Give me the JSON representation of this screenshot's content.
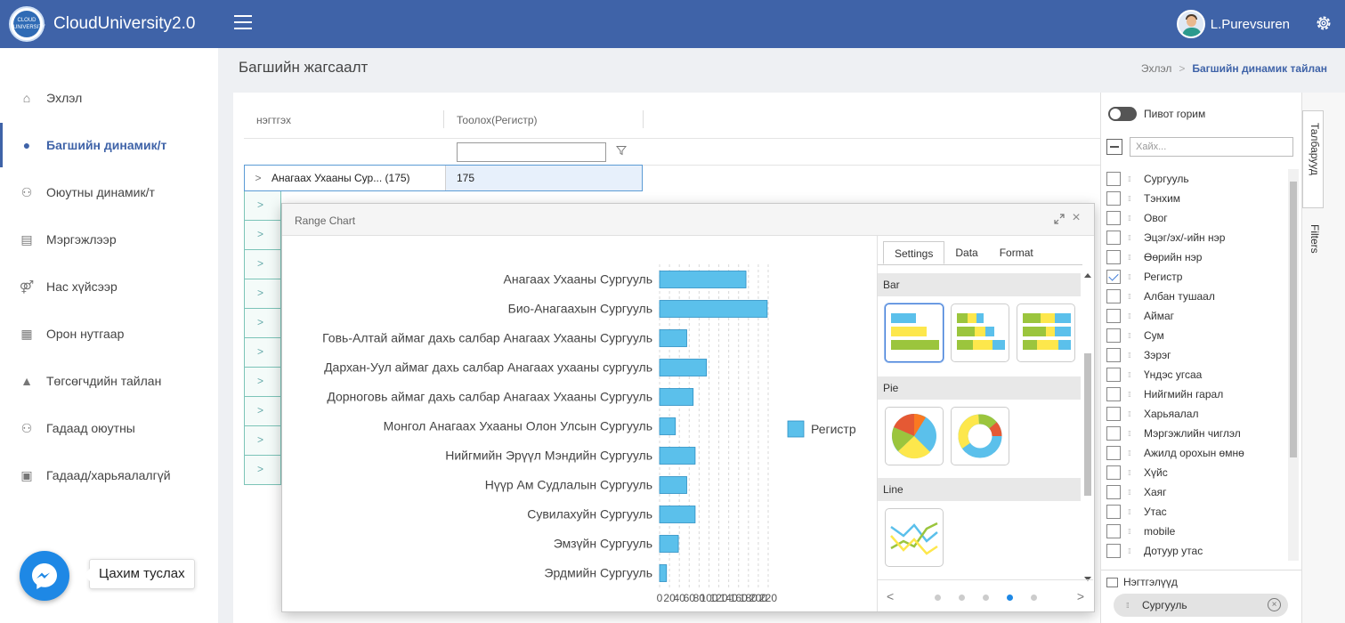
{
  "app": {
    "name": "CloudUniversity2.0",
    "logo_text": "CLOUD UNIVERSITY",
    "user_name": "L.Purevsuren"
  },
  "sidebar": {
    "items": [
      {
        "label": "Эхлэл",
        "icon": "home-icon",
        "active": false
      },
      {
        "label": "Багшийн динамик/т",
        "icon": "user-icon",
        "active": true
      },
      {
        "label": "Оюутны динамик/т",
        "icon": "users-icon",
        "active": false
      },
      {
        "label": "Мэргэжлээр",
        "icon": "id-card-icon",
        "active": false
      },
      {
        "label": "Нас хүйсээр",
        "icon": "gender-icon",
        "active": false
      },
      {
        "label": "Орон нутгаар",
        "icon": "grid-icon",
        "active": false
      },
      {
        "label": "Төгсөгчдийн тайлан",
        "icon": "graduation-cap-icon",
        "active": false
      },
      {
        "label": "Гадаад оюутны",
        "icon": "users-icon",
        "active": false
      },
      {
        "label": "Гадаад/харьяалалгүй",
        "icon": "badge-icon",
        "active": false
      }
    ],
    "help_label": "Цахим туслах"
  },
  "page": {
    "title": "Багшийн жагсаалт",
    "breadcrumb_home": "Эхлэл",
    "breadcrumb_current": "Багшийн динамик тайлан"
  },
  "grid": {
    "col_rows": "нэгтгэх",
    "col_count": "Тоолох(Регистр)",
    "first_row_label": "Анагаах Ухааны Сур... (175)",
    "first_row_value": "175",
    "collapsed_rows": 10
  },
  "dialog": {
    "title": "Range Chart",
    "tabs": [
      "Settings",
      "Data",
      "Format"
    ],
    "sections": [
      "Bar",
      "Pie",
      "Line"
    ],
    "pager_dots": 5,
    "active_dot": 3
  },
  "chart_data": {
    "type": "bar",
    "orientation": "horizontal",
    "categories": [
      "Анагаах Ухааны Сургууль",
      "Био-Анагаахын Сургууль",
      "Говь-Алтай аймаг дахь салбар Анагаах Ухааны Сургууль",
      "Дархан-Уул аймаг дахь салбар Анагаах ухааны сургууль",
      "Дорноговь аймаг дахь салбар Анагаах Ухааны Сургууль",
      "Монгол Анагаах Ухааны Олон Улсын Сургууль",
      "Нийгмийн Эрүүл Мэндийн Сургууль",
      "Нүүр Ам Судлалын Сургууль",
      "Сувилахуйн Сургууль",
      "Эмзүйн Сургууль",
      "Эрдмийн Сургууль"
    ],
    "series": [
      {
        "name": "Регистр",
        "values": [
          175,
          218,
          55,
          95,
          68,
          32,
          72,
          55,
          72,
          38,
          14
        ]
      }
    ],
    "x_ticks": [
      0,
      20,
      40,
      60,
      80,
      100,
      120,
      140,
      160,
      180,
      200,
      220
    ],
    "xlim": [
      0,
      220
    ],
    "color": "#5bc0eb",
    "grid": true,
    "legend": "right"
  },
  "fields_panel": {
    "pivot_label": "Пивот горим",
    "search_placeholder": "Хайх...",
    "fields": [
      {
        "label": "Сургууль",
        "checked": false
      },
      {
        "label": "Тэнхим",
        "checked": false
      },
      {
        "label": "Овог",
        "checked": false
      },
      {
        "label": "Эцэг/эх/-ийн нэр",
        "checked": false
      },
      {
        "label": "Өөрийн нэр",
        "checked": false
      },
      {
        "label": "Регистр",
        "checked": true
      },
      {
        "label": "Албан тушаал",
        "checked": false
      },
      {
        "label": "Аймаг",
        "checked": false
      },
      {
        "label": "Сум",
        "checked": false
      },
      {
        "label": "Зэрэг",
        "checked": false
      },
      {
        "label": "Үндэс угсаа",
        "checked": false
      },
      {
        "label": "Нийгмийн гарал",
        "checked": false
      },
      {
        "label": "Харьяалал",
        "checked": false
      },
      {
        "label": "Мэргэжлийн чиглэл",
        "checked": false
      },
      {
        "label": "Ажилд орохын өмнө",
        "checked": false
      },
      {
        "label": "Хүйс",
        "checked": false
      },
      {
        "label": "Хаяг",
        "checked": false
      },
      {
        "label": "Утас",
        "checked": false
      },
      {
        "label": "mobile",
        "checked": false
      },
      {
        "label": "Дотуур утас",
        "checked": false
      }
    ],
    "rows_label": "Нэгтгэлүүд",
    "rows_chip": "Сургууль",
    "side_tab_columns": "Талбарууд",
    "side_tab_filters": "Filters"
  }
}
